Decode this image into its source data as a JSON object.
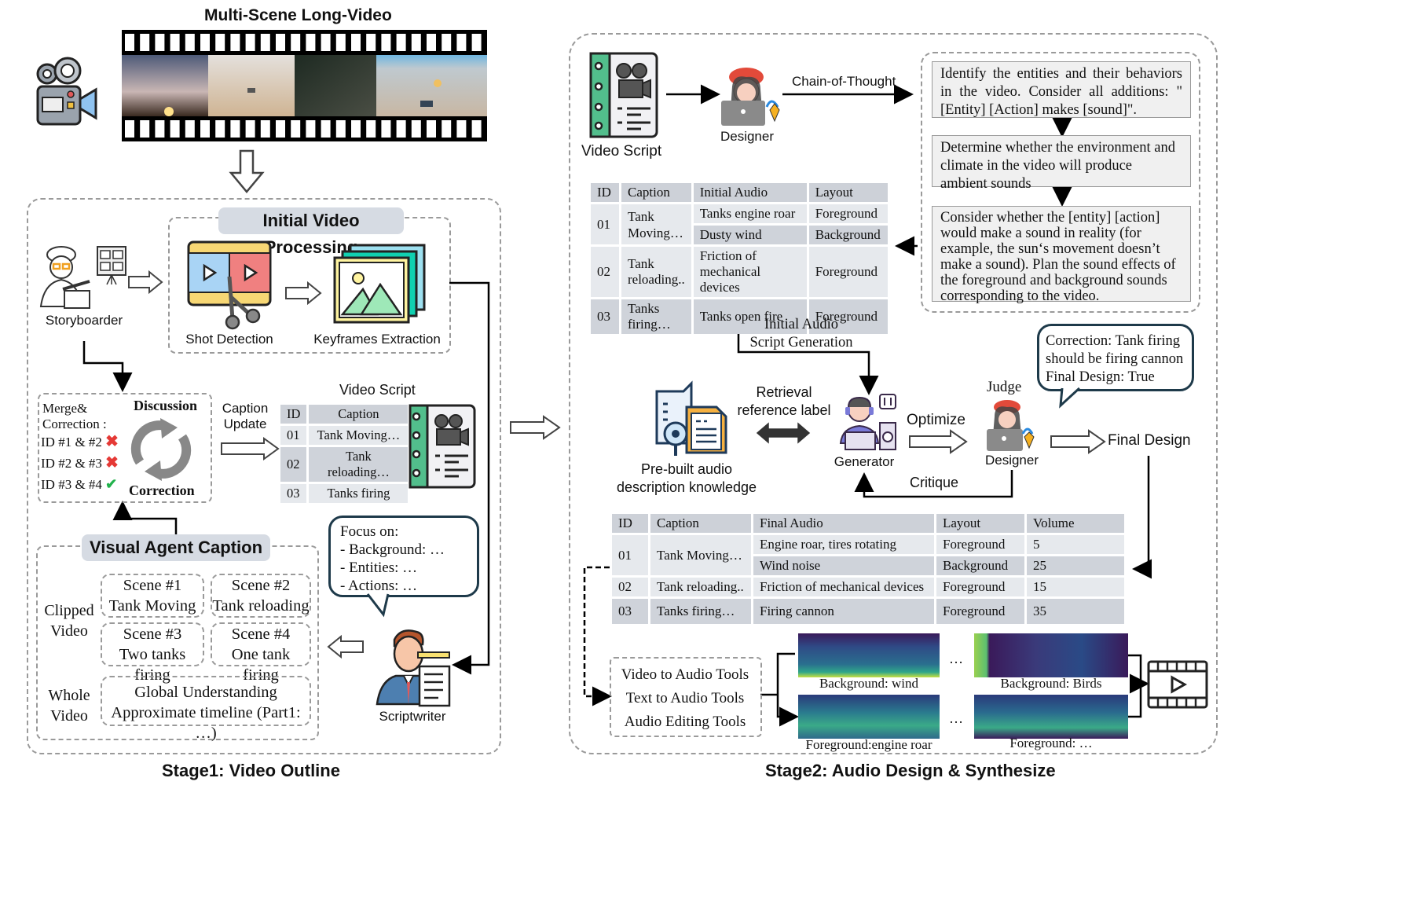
{
  "title": "Multi-Scene Long-Video",
  "stage1": {
    "caption": "Stage1: Video Outline",
    "initial_processing": {
      "label": "Initial Video Processing",
      "shot_detection": "Shot Detection",
      "keyframes_extraction": "Keyframes Extraction"
    },
    "storyboarder": "Storyboarder",
    "discussion": {
      "merge_label": "Merge&",
      "correction_label": "Correction :",
      "title_top": "Discussion",
      "title_bottom": "Correction",
      "items": [
        {
          "text": "ID #1 & #2",
          "status": "reject"
        },
        {
          "text": "ID #2 & #3",
          "status": "reject"
        },
        {
          "text": "ID #3 & #4",
          "status": "accept"
        }
      ]
    },
    "caption_update": [
      "Caption",
      "Update"
    ],
    "video_script": {
      "title": "Video Script",
      "headers": [
        "ID",
        "Caption"
      ],
      "rows": [
        [
          "01",
          "Tank Moving…"
        ],
        [
          "02",
          "Tank reloading…"
        ],
        [
          "03",
          "Tanks firing"
        ]
      ]
    },
    "visual_agent": {
      "label": "Visual Agent Caption",
      "clipped_video": [
        "Clipped",
        "Video"
      ],
      "whole_video": [
        "Whole",
        "Video"
      ],
      "scenes": [
        {
          "title": "Scene #1",
          "desc": "Tank Moving"
        },
        {
          "title": "Scene #2",
          "desc": "Tank reloading"
        },
        {
          "title": "Scene #3",
          "desc": "Two tanks firing"
        },
        {
          "title": "Scene #4",
          "desc": "One tank firing"
        }
      ],
      "global": [
        "Global Understanding",
        "Approximate timeline (Part1: …)"
      ]
    },
    "focus_bubble": [
      "Focus on:",
      "- Background: …",
      "- Entities: …",
      "- Actions: …"
    ],
    "scriptwriter": "Scriptwriter"
  },
  "stage2": {
    "caption": "Stage2: Audio Design & Synthesize",
    "video_script_label": "Video Script",
    "designer_label": "Designer",
    "chain_of_thought": "Chain-of-Thought",
    "cot_steps": [
      "Identify the entities and their behaviors in the video. Consider all additions: \"[Entity] [Action] makes [sound]\".",
      "Determine whether the environment and climate in the video will produce ambient sounds",
      "Consider whether the [entity] [action] would make a sound in reality (for example, the sun‘s movement doesn’t make a sound). Plan the sound effects of the foreground and background sounds corresponding to the video."
    ],
    "initial_table": {
      "headers": [
        "ID",
        "Caption",
        "Initial Audio",
        "Layout"
      ],
      "rows": [
        {
          "id": "01",
          "caption": "Tank Moving…",
          "audio": [
            "Tanks engine roar",
            "Dusty wind"
          ],
          "layout": [
            "Foreground",
            "Background"
          ]
        },
        {
          "id": "02",
          "caption": "Tank reloading..",
          "audio": [
            "Friction of mechanical devices"
          ],
          "layout": [
            "Foreground"
          ]
        },
        {
          "id": "03",
          "caption": "Tanks firing…",
          "audio": [
            "Tanks open fire"
          ],
          "layout": [
            "Foreground"
          ]
        }
      ]
    },
    "initial_audio_gen": [
      "Initial Audio",
      "Script Generation"
    ],
    "retrieval": [
      "Retrieval",
      "reference label"
    ],
    "knowledge": [
      "Pre-built audio",
      "description knowledge"
    ],
    "generator": "Generator",
    "optimize": "Optimize",
    "critique": "Critique",
    "judge": "Judge",
    "judge_designer": "Designer",
    "final_design": "Final Design",
    "correction_bubble": [
      "Correction: Tank firing",
      "should be firing cannon",
      "Final Design:  True"
    ],
    "final_table": {
      "headers": [
        "ID",
        "Caption",
        "Final Audio",
        "Layout",
        "Volume"
      ],
      "rows": [
        {
          "id": "01",
          "caption": "Tank Moving…",
          "audio": [
            "Engine roar, tires rotating",
            "Wind noise"
          ],
          "layout": [
            "Foreground",
            "Background"
          ],
          "volume": [
            "5",
            "25"
          ]
        },
        {
          "id": "02",
          "caption": "Tank reloading..",
          "audio": [
            "Friction of mechanical devices"
          ],
          "layout": [
            "Foreground"
          ],
          "volume": [
            "15"
          ]
        },
        {
          "id": "03",
          "caption": "Tanks firing…",
          "audio": [
            "Firing cannon"
          ],
          "layout": [
            "Foreground"
          ],
          "volume": [
            "35"
          ]
        }
      ]
    },
    "tools": [
      "Video to Audio Tools",
      "Text to Audio Tools",
      "Audio Editing Tools"
    ],
    "spectrograms": [
      {
        "label": "Background: wind"
      },
      {
        "label": "Background: Birds"
      },
      {
        "label": "Foreground:engine roar"
      },
      {
        "label": "Foreground: …"
      }
    ],
    "ellipsis": "…"
  }
}
